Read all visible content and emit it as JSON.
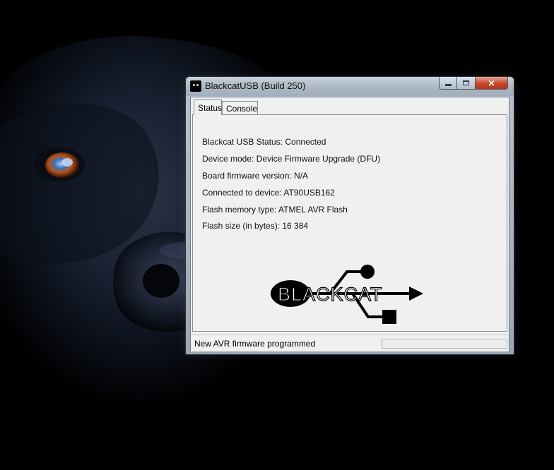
{
  "window": {
    "title": "BlackcatUSB (Build 250)"
  },
  "tabs": [
    {
      "label": "Status",
      "active": true
    },
    {
      "label": "Console",
      "active": false
    }
  ],
  "status_panel": {
    "lines": [
      "Blackcat USB Status: Connected",
      "Device mode: Device Firmware Upgrade (DFU)",
      "Board firmware version: N/A",
      "Connected to device: AT90USB162",
      "Flash memory type: ATMEL AVR Flash",
      "Flash size (in bytes): 16 384"
    ],
    "logo_text": "BLACKCAT"
  },
  "statusbar": {
    "message": "New AVR firmware programmed",
    "progress": 0
  },
  "colors": {
    "close_button": "#c8472c",
    "client_bg": "#f0f0f0"
  }
}
